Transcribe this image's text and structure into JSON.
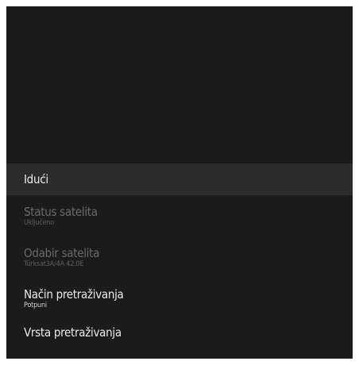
{
  "menu": {
    "items": [
      {
        "title": "Idući",
        "state": "focused"
      },
      {
        "title": "Status satelita",
        "value": "Uključeno",
        "state": "disabled"
      },
      {
        "title": "Odabir satelita",
        "value": "Türksat3A/4A 42.0E",
        "state": "disabled"
      },
      {
        "title": "Način pretraživanja",
        "value": "Potpuni",
        "state": "enabled"
      },
      {
        "title": "Vrsta pretraživanja",
        "state": "enabled"
      }
    ]
  },
  "colors": {
    "screen_bg": "#1b1b1b",
    "focus_bg": "#2c2c2c",
    "text_enabled": "#eaeaea",
    "text_disabled": "#6a6a6a"
  }
}
